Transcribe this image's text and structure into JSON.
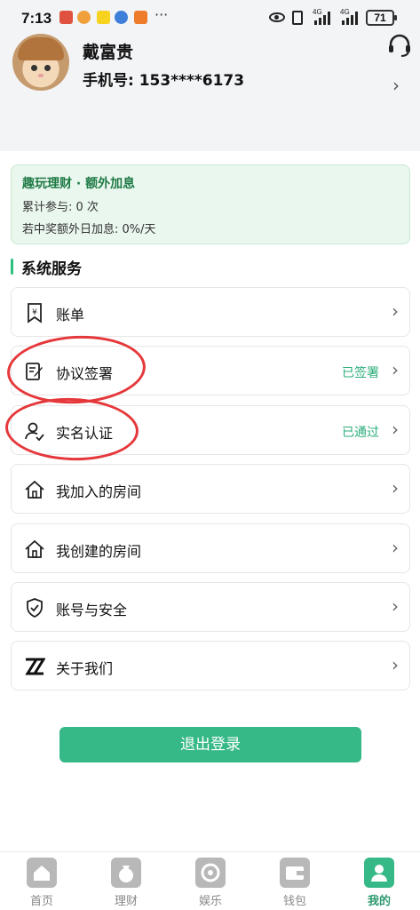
{
  "status_bar": {
    "time": "7:13",
    "more": "···",
    "battery": "71",
    "network_1": "4G",
    "network_2": "4G"
  },
  "profile": {
    "name": "戴富贵",
    "phone": "手机号: 153****6173"
  },
  "promo": {
    "title": "趣玩理财 · 额外加息",
    "participations": "累计参与:  0 次",
    "extra_rate": "若中奖额外日加息:  0%/天"
  },
  "section": {
    "title": "系统服务"
  },
  "menu": [
    {
      "label": "账单",
      "status": "",
      "icon": "bill-icon"
    },
    {
      "label": "协议签署",
      "status": "已签署",
      "icon": "contract-sign-icon"
    },
    {
      "label": "实名认证",
      "status": "已通过",
      "icon": "user-verify-icon"
    },
    {
      "label": "我加入的房间",
      "status": "",
      "icon": "house-icon"
    },
    {
      "label": "我创建的房间",
      "status": "",
      "icon": "house-icon"
    },
    {
      "label": "账号与安全",
      "status": "",
      "icon": "shield-check-icon"
    },
    {
      "label": "关于我们",
      "status": "",
      "icon": "logo-z-icon"
    }
  ],
  "logout_label": "退出登录",
  "tabs": [
    {
      "label": "首页",
      "icon": "home-icon",
      "active": false
    },
    {
      "label": "理财",
      "icon": "money-bag-icon",
      "active": false
    },
    {
      "label": "娱乐",
      "icon": "game-icon",
      "active": false
    },
    {
      "label": "钱包",
      "icon": "wallet-icon",
      "active": false
    },
    {
      "label": "我的",
      "icon": "profile-icon",
      "active": true
    }
  ],
  "colors": {
    "accent": "#37b987",
    "status_green": "#2bae7a",
    "annotation_red": "#e5383b"
  }
}
